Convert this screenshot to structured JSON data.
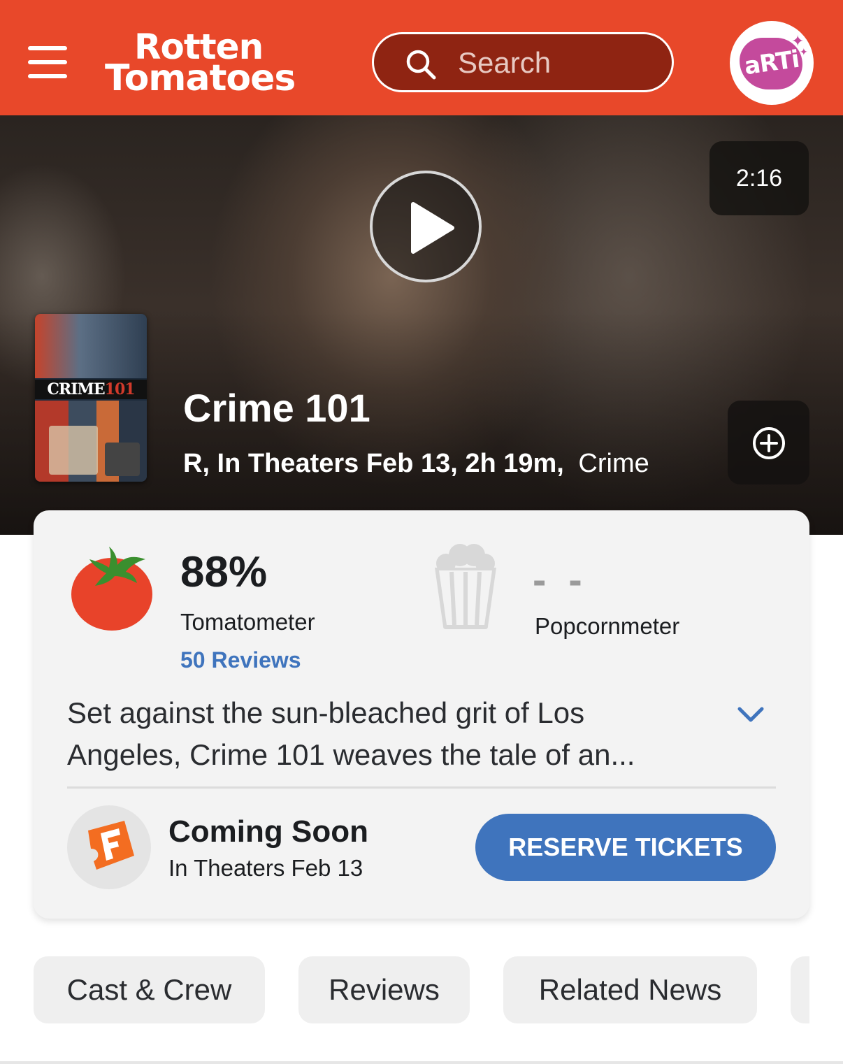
{
  "header": {
    "logo_line1": "Rotten",
    "logo_line2": "Tomatoes",
    "search_placeholder": "Search",
    "avatar_label": "aRTi",
    "brand_color": "#e8482a"
  },
  "hero": {
    "duration": "2:16",
    "title": "Crime 101",
    "meta_details": "R, In Theaters Feb 13, 2h 19m,",
    "genre": "Crime",
    "poster_text_a": "CRIME",
    "poster_text_b": "101",
    "icons": {
      "play": "play-icon",
      "add": "plus-circle-icon"
    }
  },
  "scores": {
    "tomatometer_score": "88%",
    "tomatometer_label": "Tomatometer",
    "reviews_count": "50 Reviews",
    "popcornmeter_score": "- -",
    "popcornmeter_label": "Popcornmeter",
    "accent_color": "#3f74bd"
  },
  "synopsis": {
    "text": "Set against the sun-bleached grit of Los Angeles, Crime 101 weaves the tale of an..."
  },
  "tickets": {
    "status": "Coming Soon",
    "subtitle": "In Theaters Feb 13",
    "button_label": "RESERVE TICKETS"
  },
  "tabs": [
    {
      "label": "Cast & Crew"
    },
    {
      "label": "Reviews"
    },
    {
      "label": "Related News"
    }
  ]
}
